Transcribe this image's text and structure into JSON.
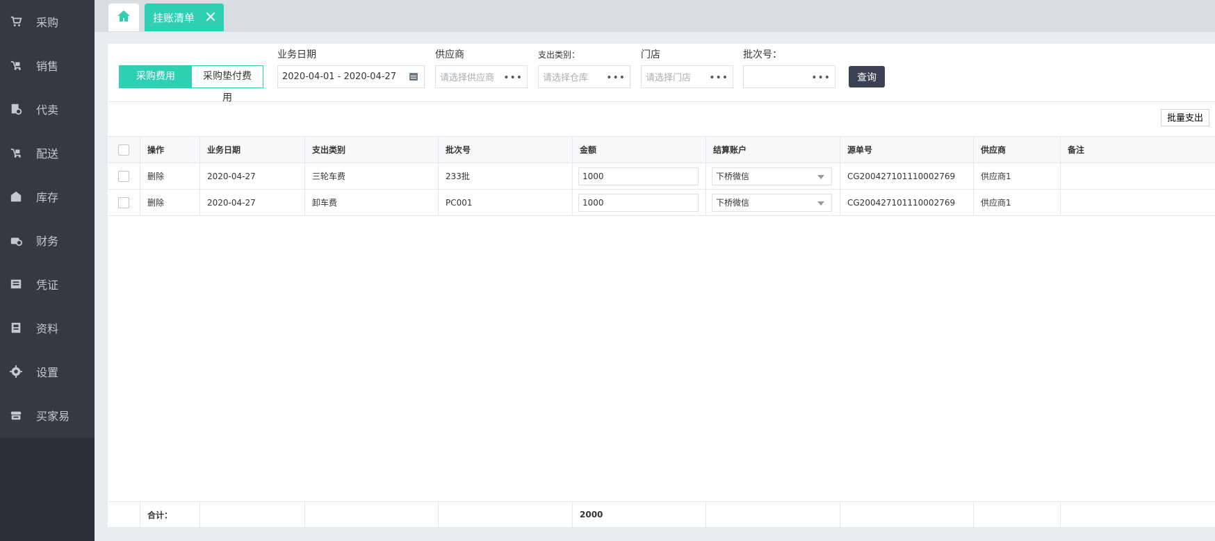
{
  "sidebar": {
    "items": [
      {
        "label": "采购",
        "icon": "cart-icon"
      },
      {
        "label": "销售",
        "icon": "trolley-icon"
      },
      {
        "label": "代卖",
        "icon": "consign-icon"
      },
      {
        "label": "配送",
        "icon": "delivery-icon"
      },
      {
        "label": "库存",
        "icon": "warehouse-icon"
      },
      {
        "label": "财务",
        "icon": "finance-icon"
      },
      {
        "label": "凭证",
        "icon": "voucher-icon"
      },
      {
        "label": "资料",
        "icon": "document-icon"
      },
      {
        "label": "设置",
        "icon": "gear-icon"
      },
      {
        "label": "买家易",
        "icon": "store-icon"
      }
    ]
  },
  "tabs": {
    "active_label": "挂账清单"
  },
  "filters": {
    "toggle_on": "采购费用",
    "toggle_off": "采购垫付费用",
    "date_label": "业务日期",
    "date_value": "2020-04-01 - 2020-04-27",
    "supplier_label": "供应商",
    "supplier_placeholder": "请选择供应商",
    "expense_label": "支出类别：",
    "expense_placeholder": "请选择仓库",
    "store_label": "门店",
    "store_placeholder": "请选择门店",
    "batch_label": "批次号：",
    "batch_value": "",
    "query_label": "查询"
  },
  "actions": {
    "batch_pay": "批量支出"
  },
  "table": {
    "headers": [
      "操作",
      "业务日期",
      "支出类别",
      "批次号",
      "金额",
      "结算账户",
      "源单号",
      "供应商",
      "备注"
    ],
    "rows": [
      {
        "op": "删除",
        "date": "2020-04-27",
        "category": "三轮车费",
        "batch": "233批",
        "amount": "1000",
        "account": "下桥微信",
        "source": "CG200427101110002769",
        "supplier": "供应商1",
        "remark": ""
      },
      {
        "op": "删除",
        "date": "2020-04-27",
        "category": "卸车费",
        "batch": "PC001",
        "amount": "1000",
        "account": "下桥微信",
        "source": "CG200427101110002769",
        "supplier": "供应商1",
        "remark": ""
      }
    ],
    "footer": {
      "label": "合计：",
      "total": "2000"
    }
  },
  "colors": {
    "accent": "#2ecfb3",
    "sidebar": "#2b2f3a",
    "query_button": "#3a4152"
  }
}
